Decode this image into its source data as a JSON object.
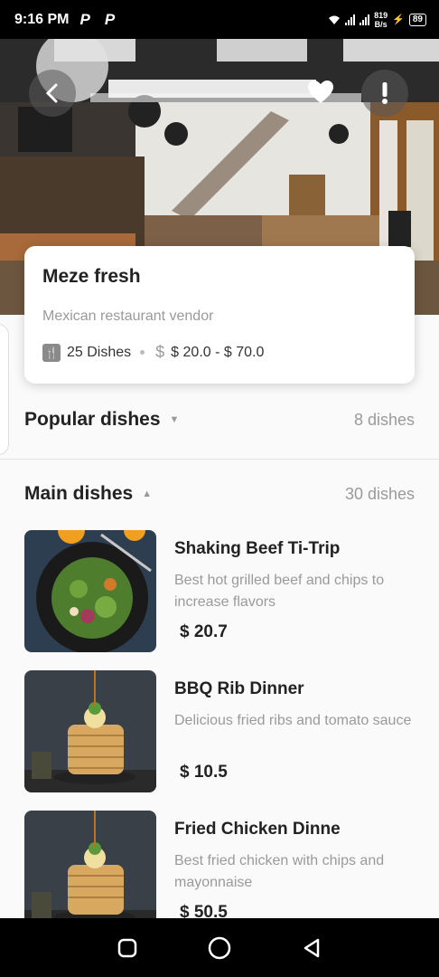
{
  "status_bar": {
    "time": "9:16 PM",
    "notification_icons": "P P",
    "netspeed_value": "819",
    "netspeed_unit": "B/s",
    "battery": "89"
  },
  "hero": {
    "image": "restaurant-interior-photo"
  },
  "vendor": {
    "name": "Meze fresh",
    "subtitle": "Mexican restaurant vendor",
    "dishes_count": "25 Dishes",
    "price_range": "$ 20.0 - $ 70.0"
  },
  "sections": [
    {
      "title": "Popular dishes",
      "count": "8 dishes",
      "expanded": false
    },
    {
      "title": "Main dishes",
      "count": "30 dishes",
      "expanded": true
    }
  ],
  "dishes": [
    {
      "name": "Shaking Beef Ti-Trip",
      "description": "Best hot grilled beef and chips to increase flavors",
      "price": "$ 20.7"
    },
    {
      "name": "BBQ Rib Dinner",
      "description": "Delicious fried ribs and tomato sauce",
      "price": "$ 10.5"
    },
    {
      "name": "Fried Chicken Dinne",
      "description": "Best fried chicken with chips and mayonnaise",
      "price": "$ 50.5"
    }
  ],
  "colors": {
    "accent_dark": "#222222",
    "muted_text": "#9a9a9a",
    "background": "#fafafa"
  }
}
